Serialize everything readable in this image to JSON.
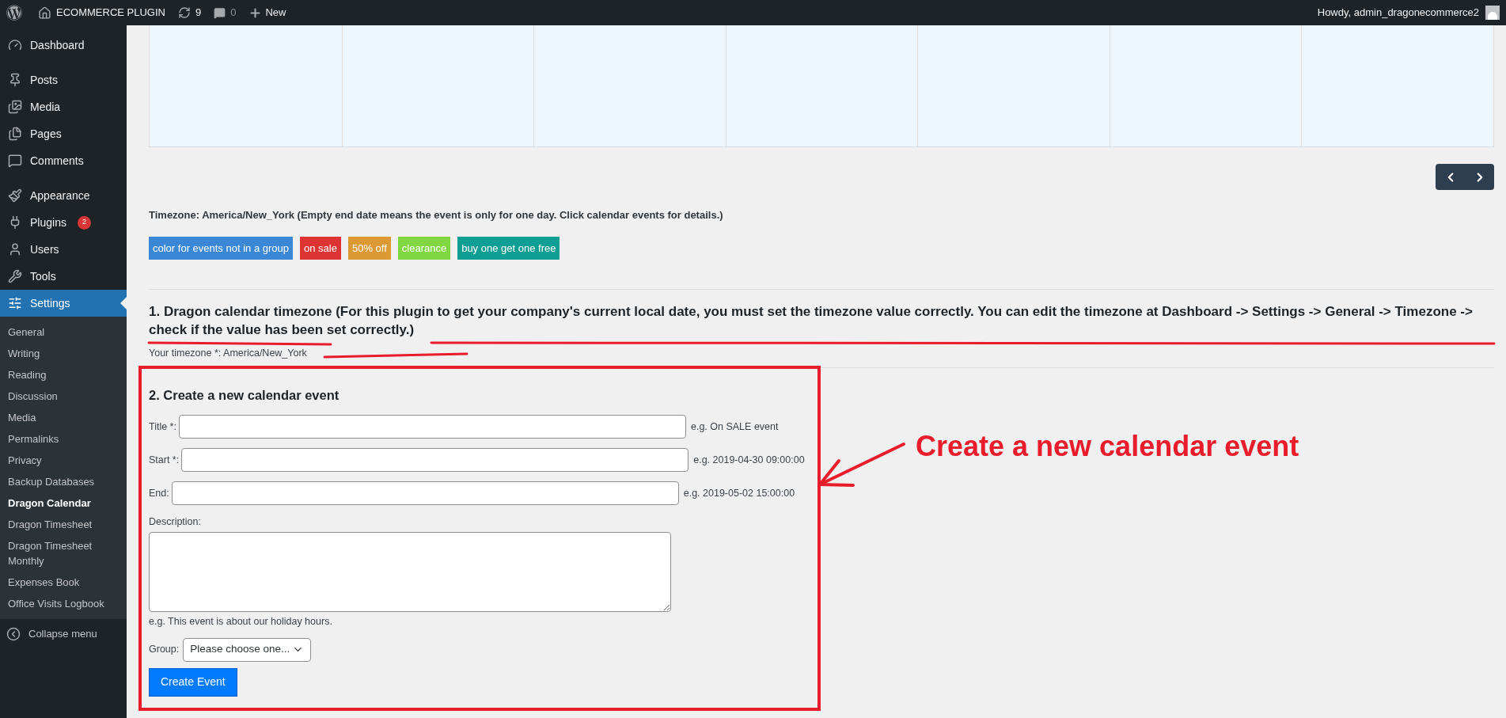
{
  "admin_bar": {
    "site_name": "ECOMMERCE PLUGIN",
    "updates_count": "9",
    "comments_count": "0",
    "new_label": "New",
    "greeting": "Howdy, admin_dragonecommerce2"
  },
  "sidebar": {
    "menu_groups": [
      [
        {
          "label": "Dashboard",
          "selected": false
        }
      ],
      [
        {
          "label": "Posts",
          "selected": false
        },
        {
          "label": "Media",
          "selected": false
        },
        {
          "label": "Pages",
          "selected": false
        },
        {
          "label": "Comments",
          "selected": false
        }
      ],
      [
        {
          "label": "Appearance",
          "selected": false
        },
        {
          "label": "Plugins",
          "badge": "2",
          "selected": false
        },
        {
          "label": "Users",
          "selected": false
        },
        {
          "label": "Tools",
          "selected": false
        },
        {
          "label": "Settings",
          "selected": true
        }
      ]
    ],
    "submenu": [
      {
        "label": "General",
        "selected": false
      },
      {
        "label": "Writing",
        "selected": false
      },
      {
        "label": "Reading",
        "selected": false
      },
      {
        "label": "Discussion",
        "selected": false
      },
      {
        "label": "Media",
        "selected": false
      },
      {
        "label": "Permalinks",
        "selected": false
      },
      {
        "label": "Privacy",
        "selected": false
      },
      {
        "label": "Backup Databases",
        "selected": false
      },
      {
        "label": "Dragon Calendar",
        "selected": true
      },
      {
        "label": "Dragon Timesheet",
        "selected": false
      },
      {
        "label": "Dragon Timesheet Monthly",
        "selected": false
      },
      {
        "label": "Expenses Book",
        "selected": false
      },
      {
        "label": "Office Visits Logbook",
        "selected": false
      }
    ],
    "collapse_label": "Collapse menu"
  },
  "timezone_note": "Timezone: America/New_York (Empty end date means the event is only for one day. Click calendar events for details.)",
  "legend": [
    {
      "label": "color for events not in a group",
      "color": "#3a87d6"
    },
    {
      "label": "on sale",
      "color": "#dd3333"
    },
    {
      "label": "50% off",
      "color": "#dd9933"
    },
    {
      "label": "clearance",
      "color": "#81d742"
    },
    {
      "label": "buy one get one free",
      "color": "#0e9e94"
    }
  ],
  "section_timezone": {
    "heading": "1. Dragon calendar timezone (For this plugin to get your company's current local date, you must set the timezone value correctly. You can edit the timezone at Dashboard -> Settings -> General -> Timezone -> check if the value has been set correctly.)",
    "current": "Your timezone *: America/New_York"
  },
  "form": {
    "heading": "2. Create a new calendar event",
    "fields": [
      {
        "label": "Title *:",
        "hint": "e.g. On SALE event"
      },
      {
        "label": "Start *:",
        "hint": "e.g. 2019-04-30 09:00:00"
      },
      {
        "label": "End:",
        "hint": "e.g. 2019-05-02 15:00:00"
      }
    ],
    "description_label": "Description:",
    "description_hint": "e.g. This event is about our holiday hours.",
    "group_label": "Group:",
    "group_value": "Please choose one...",
    "submit": "Create Event"
  },
  "annotation": {
    "callout": "Create a new calendar event"
  }
}
